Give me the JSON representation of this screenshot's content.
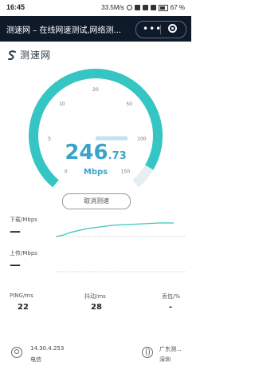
{
  "status_bar": {
    "time": "16:45",
    "net_speed": "33.5M/s",
    "battery": "67 %"
  },
  "nav": {
    "title": "测速网 – 在线网速测试,网络测..."
  },
  "brand": {
    "name": "测速网"
  },
  "gauge": {
    "ticks": [
      "0",
      "5",
      "10",
      "20",
      "50",
      "100",
      "150"
    ],
    "speed_int": "246",
    "speed_dec": ".73",
    "unit": "Mbps",
    "level": 0.93,
    "accent": "#35c6c4",
    "track": "#e6eef1"
  },
  "cancel_label": "取消测速",
  "download": {
    "label": "下载/Mbps",
    "value": "—"
  },
  "upload": {
    "label": "上传/Mbps",
    "value": "—"
  },
  "stats": {
    "ping": {
      "label": "PING/ms",
      "value": "22"
    },
    "jitter": {
      "label": "抖动/ms",
      "value": "28"
    },
    "loss": {
      "label": "丢包/%",
      "value": "-"
    }
  },
  "client": {
    "ip": "14.30.4.253",
    "isp": "电信"
  },
  "server": {
    "name": "广东测...",
    "city": "深圳"
  }
}
